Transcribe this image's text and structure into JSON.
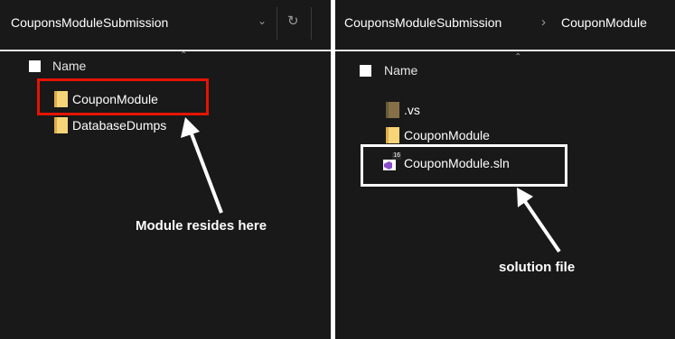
{
  "left_window": {
    "address_path": "CouponsModuleSubmission",
    "dropdown_icon": "chevron-down-icon",
    "refresh_icon": "refresh-icon",
    "column_header": "Name",
    "items": [
      {
        "label": "CouponModule",
        "icon": "folder-icon"
      },
      {
        "label": "DatabaseDumps",
        "icon": "folder-icon"
      }
    ],
    "annotation": "Module resides here",
    "highlight_color": "#e51400"
  },
  "right_window": {
    "breadcrumb_1": "CouponsModuleSubmission",
    "breadcrumb_separator": "›",
    "breadcrumb_2": "CouponModule",
    "column_header": "Name",
    "items": [
      {
        "label": ".vs",
        "icon": "folder-icon"
      },
      {
        "label": "CouponModule",
        "icon": "folder-icon"
      },
      {
        "label": "CouponModule.sln",
        "icon": "visual-studio-solution-icon",
        "badge": "16"
      }
    ],
    "annotation": "solution file",
    "highlight_color": "#ffffff"
  },
  "colors": {
    "background": "#191919",
    "folder": "#f6d478",
    "text": "#ffffff"
  }
}
